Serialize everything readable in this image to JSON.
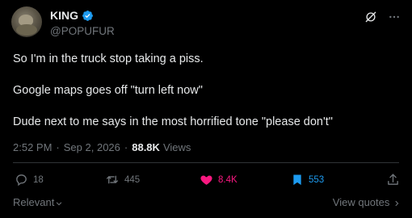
{
  "author": {
    "name": "KING",
    "handle": "@POPUFUR",
    "verified": true
  },
  "tweet": {
    "lines": [
      "So I'm in the truck stop taking a piss.",
      "Google maps goes off \"turn left now\"",
      "Dude next to me says in the most horrified tone \"please don't\""
    ]
  },
  "meta": {
    "time": "2:52 PM",
    "separator": "·",
    "date": "Sep 2, 2026",
    "views_count": "88.8K",
    "views_label": "Views"
  },
  "actions": {
    "replies": "18",
    "reposts": "445",
    "likes": "8.4K",
    "bookmarks": "553"
  },
  "footer": {
    "relevant": "Relevant",
    "view_quotes": "View quotes"
  },
  "colors": {
    "background": "#000000",
    "text": "#e7e9ea",
    "muted": "#71767b",
    "verified": "#1d9bf0",
    "like": "#f91880",
    "bookmark": "#1d9bf0"
  }
}
